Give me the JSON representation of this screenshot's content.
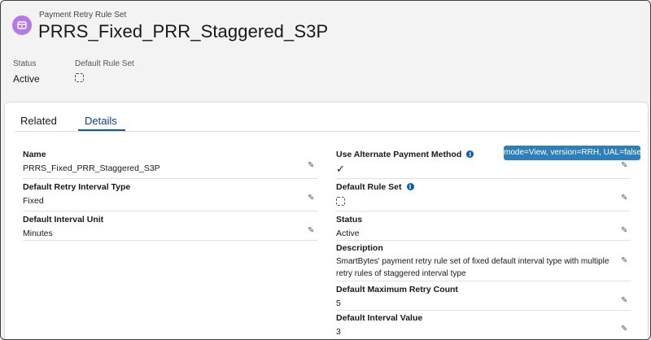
{
  "header": {
    "object_label": "Payment Retry Rule Set",
    "record_title": "PRRS_Fixed_PRR_Staggered_S3P",
    "highlights": [
      {
        "label": "Status",
        "value": "Active"
      },
      {
        "label": "Default Rule Set",
        "value": ""
      }
    ]
  },
  "tabs": [
    {
      "label": "Related",
      "active": false
    },
    {
      "label": "Details",
      "active": true
    }
  ],
  "debug_badge": "mode=View, version=RRH, UAL=false",
  "details": {
    "left": [
      {
        "label": "Name",
        "value": "PRRS_Fixed_PRR_Staggered_S3P"
      },
      {
        "label": "Default Retry Interval Type",
        "value": "Fixed"
      },
      {
        "label": "Default Interval Unit",
        "value": "Minutes"
      }
    ],
    "right": [
      {
        "label": "Use Alternate Payment Method",
        "value": "✓",
        "checkbox": true,
        "checked": true,
        "info": true
      },
      {
        "label": "Default Rule Set",
        "value": "",
        "checkbox": true,
        "checked": false,
        "info": true
      },
      {
        "label": "Status",
        "value": "Active"
      },
      {
        "label": "Description",
        "value_line1": "SmartBytes' payment retry rule set of fixed default interval type with multiple",
        "value_line2": "retry rules of staggered interval type"
      },
      {
        "label": "Default Maximum Retry Count",
        "value": "5"
      },
      {
        "label": "Default Interval Value",
        "value": "3"
      }
    ]
  },
  "colors": {
    "object_icon": "#b37ae6",
    "tab_active": "#0b5cab",
    "badge": "#2e7eb8"
  },
  "icons": {
    "object_icon": "payment-retry-rule-set-icon",
    "edit": "pencil-icon",
    "info": "info-icon"
  }
}
